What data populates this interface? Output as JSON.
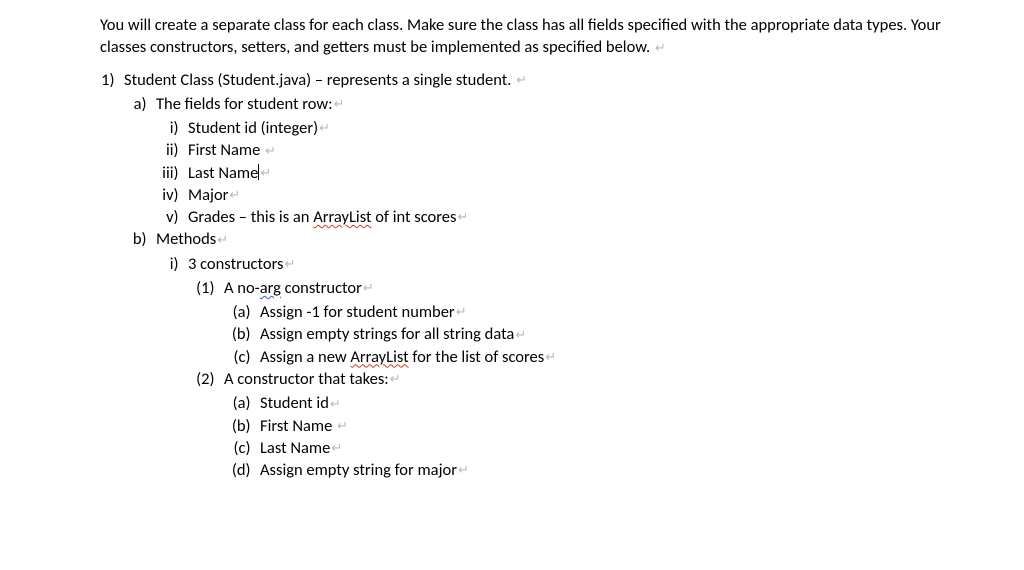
{
  "intro": {
    "sentence": "You will create a separate class for each class. Make sure the class has all fields specified with the appropriate data types. Your classes constructors, setters, and getters must be implemented as specified below. "
  },
  "list1": {
    "item1": {
      "prefix": "Student Class (Student.java) – represents a single student. ",
      "a": {
        "label": "The fields for student row:",
        "i": "Student id (integer)",
        "ii": "First Name ",
        "iii_pre": "Last Name",
        "iv": "Major",
        "v_pre": "Grades – this is an ",
        "v_word": "ArrayList",
        "v_post": " of int scores"
      },
      "b": {
        "label": "Methods",
        "i": {
          "label": "3 constructors",
          "one": {
            "label_pre": "A no-",
            "label_word": "arg",
            "label_post": " constructor",
            "a": "Assign -1 for student number",
            "b": "Assign empty strings for all string data",
            "c_pre": "Assign a new ",
            "c_word": "ArrayList",
            "c_post": " for the list of scores"
          },
          "two": {
            "label": "A constructor that takes:",
            "a": "Student id",
            "b": "First Name ",
            "c": "Last Name",
            "d": "Assign empty string for major"
          }
        }
      }
    }
  },
  "glyph": "↵"
}
